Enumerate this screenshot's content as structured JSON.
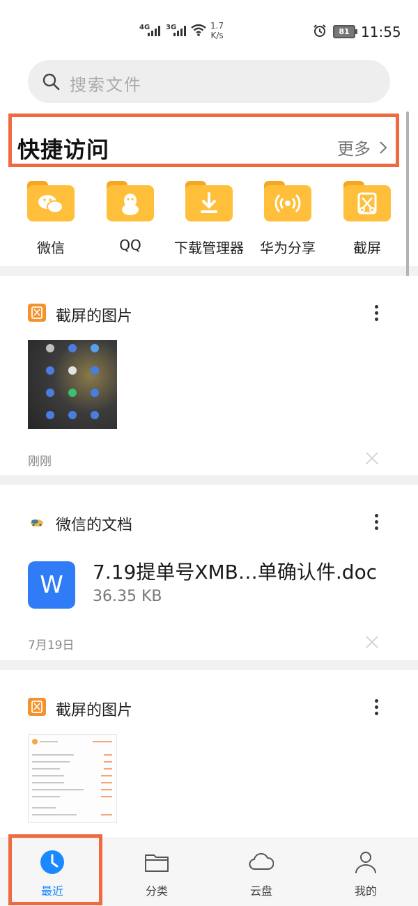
{
  "status_bar": {
    "signal1": "4G",
    "signal2": "3G",
    "speed_value": "1.7",
    "speed_unit": "K/s",
    "battery": "81",
    "time": "11:55",
    "icons": [
      "signal-icon",
      "wifi-icon",
      "alarm-icon",
      "battery-icon"
    ]
  },
  "search": {
    "placeholder": "搜索文件"
  },
  "quick_access": {
    "title": "快捷访问",
    "more": "更多",
    "items": [
      {
        "label": "微信",
        "icon": "wechat-icon"
      },
      {
        "label": "QQ",
        "icon": "qq-icon"
      },
      {
        "label": "下载管理器",
        "icon": "download-icon"
      },
      {
        "label": "华为分享",
        "icon": "share-icon"
      },
      {
        "label": "截屏",
        "icon": "screenshot-icon"
      }
    ]
  },
  "cards": [
    {
      "title": "截屏的图片",
      "time": "刚刚",
      "icon": "screenshot-icon"
    },
    {
      "title": "微信的文档",
      "time": "7月19日",
      "icon": "wechat-doc-icon",
      "file": {
        "name": "7.19提单号XMB…单确认件.doc",
        "size": "36.35 KB",
        "type_letter": "W"
      }
    },
    {
      "title": "截屏的图片",
      "icon": "screenshot-icon"
    }
  ],
  "bottom_nav": {
    "items": [
      {
        "label": "最近",
        "icon": "clock-icon",
        "active": true
      },
      {
        "label": "分类",
        "icon": "folder-icon",
        "active": false
      },
      {
        "label": "云盘",
        "icon": "cloud-icon",
        "active": false
      },
      {
        "label": "我的",
        "icon": "person-icon",
        "active": false
      }
    ]
  },
  "colors": {
    "accent": "#1a88ff",
    "folder": "#ffbf3a",
    "highlight": "#ef6a40",
    "file_word": "#2f7cf6"
  }
}
